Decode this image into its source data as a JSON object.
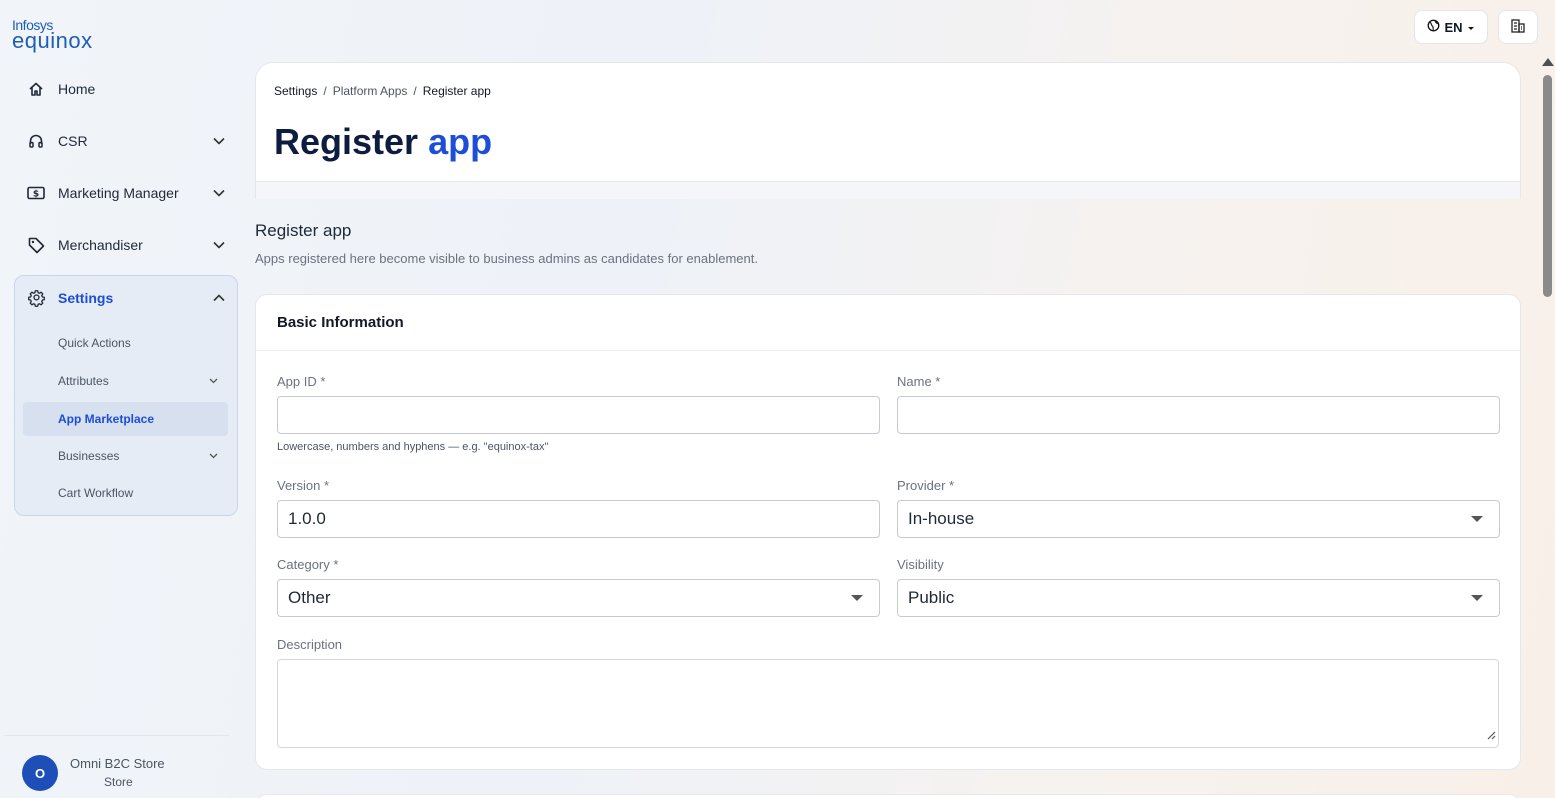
{
  "brand": {
    "line1": "Infosys",
    "line2": "equinox"
  },
  "topbar": {
    "language": "EN"
  },
  "sidebar": {
    "items": [
      {
        "label": "Home",
        "icon": "home-icon"
      },
      {
        "label": "CSR",
        "icon": "headset-icon"
      },
      {
        "label": "Marketing Manager",
        "icon": "dollar-icon"
      },
      {
        "label": "Merchandiser",
        "icon": "tag-icon"
      },
      {
        "label": "Settings",
        "icon": "gear-icon"
      }
    ],
    "settings_sub": [
      {
        "label": "Quick Actions"
      },
      {
        "label": "Attributes"
      },
      {
        "label": "App Marketplace"
      },
      {
        "label": "Businesses"
      },
      {
        "label": "Cart Workflow"
      }
    ],
    "store": {
      "initial": "O",
      "name": "Omni B2C Store",
      "type": "Store"
    }
  },
  "breadcrumb": {
    "c1": "Settings",
    "sep": "/",
    "c2": "Platform Apps",
    "c3": "Register app"
  },
  "page": {
    "title_part1": "Register",
    "title_part2": "app"
  },
  "section": {
    "title": "Register app",
    "description": "Apps registered here become visible to business admins as candidates for enablement."
  },
  "form": {
    "card_title": "Basic Information",
    "app_id": {
      "label": "App ID *",
      "value": "",
      "hint": "Lowercase, numbers and hyphens — e.g. \"equinox-tax\""
    },
    "name": {
      "label": "Name *",
      "value": ""
    },
    "version": {
      "label": "Version *",
      "value": "1.0.0"
    },
    "provider": {
      "label": "Provider *",
      "value": "In-house"
    },
    "category": {
      "label": "Category *",
      "value": "Other"
    },
    "visibility": {
      "label": "Visibility",
      "value": "Public"
    },
    "description": {
      "label": "Description",
      "value": ""
    }
  },
  "colors": {
    "accent": "#1d4ed8",
    "title": "#0e1c3f",
    "avatar": "#1e4fb8"
  }
}
